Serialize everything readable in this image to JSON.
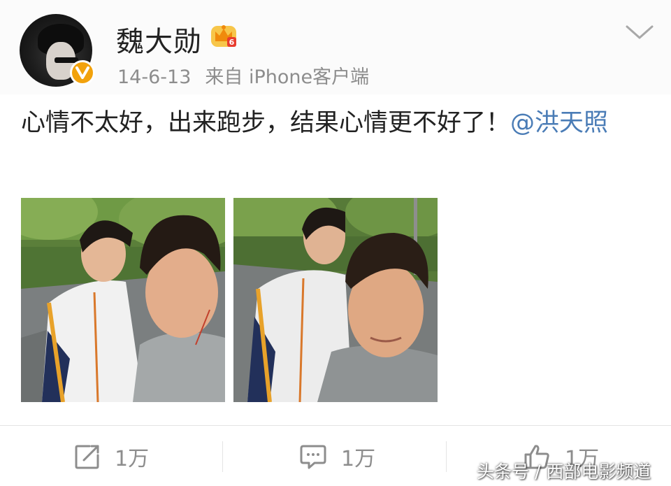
{
  "header": {
    "username": "魏大勋",
    "date": "14-6-13",
    "source": "来自 iPhone客户端",
    "vip_level": "6",
    "vip_icon": "crown-vip-icon",
    "verified_icon": "verified-v-icon",
    "menu_icon": "chevron-down-icon"
  },
  "post": {
    "text": "心情不太好，出来跑步，结果心情更不好了！",
    "mention": "@洪天照"
  },
  "photos": [
    {
      "name": "photo-1"
    },
    {
      "name": "photo-2"
    }
  ],
  "toolbar": {
    "repost_icon": "repost-icon",
    "repost_count": "1万",
    "comment_icon": "comment-icon",
    "comment_count": "1万",
    "like_icon": "like-icon",
    "like_count": "1万"
  },
  "watermark": "头条号 / 西部电影频道",
  "colors": {
    "mention": "#4a7cb6",
    "meta_text": "#8d8d8d",
    "verified_badge": "#f2a20c",
    "vip_crown": "#f2a20c",
    "vip_level": "#e83c2e"
  }
}
